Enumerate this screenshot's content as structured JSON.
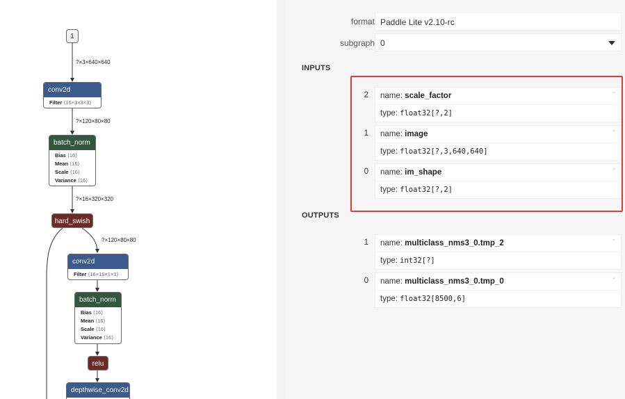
{
  "graph": {
    "input_node": "1",
    "edge_labels": [
      "?×3×640×640",
      "?×120×80×80",
      "?×16×320×320",
      "?×120×80×80"
    ],
    "nodes": [
      {
        "id": "conv2d-1",
        "title": "conv2d",
        "attrs": [
          {
            "k": "Filter",
            "v": "⟨16×3×3×3⟩"
          }
        ]
      },
      {
        "id": "batch-norm-1",
        "title": "batch_norm",
        "attrs": [
          {
            "k": "Bias",
            "v": "⟨16⟩"
          },
          {
            "k": "Mean",
            "v": "⟨16⟩"
          },
          {
            "k": "Scale",
            "v": "⟨16⟩"
          },
          {
            "k": "Variance",
            "v": "⟨16⟩"
          }
        ]
      },
      {
        "id": "hard-swish",
        "title": "hard_swish"
      },
      {
        "id": "conv2d-2",
        "title": "conv2d",
        "attrs": [
          {
            "k": "Filter",
            "v": "⟨16×16×1×1⟩"
          }
        ]
      },
      {
        "id": "batch-norm-2",
        "title": "batch_norm",
        "attrs": [
          {
            "k": "Bias",
            "v": "⟨16⟩"
          },
          {
            "k": "Mean",
            "v": "⟨16⟩"
          },
          {
            "k": "Scale",
            "v": "⟨16⟩"
          },
          {
            "k": "Variance",
            "v": "⟨16⟩"
          }
        ]
      },
      {
        "id": "relu",
        "title": "relu"
      },
      {
        "id": "depthwise-conv2d",
        "title": "depthwise_conv2d"
      }
    ]
  },
  "properties": {
    "format_label": "format",
    "format_value": "Paddle Lite v2.10-rc",
    "subgraph_label": "subgraph",
    "subgraph_value": "0"
  },
  "inputs": {
    "title": "INPUTS",
    "items": [
      {
        "index": "2",
        "name_label": "name: ",
        "name": "scale_factor",
        "type_label": "type: ",
        "type": "float32[?,2]",
        "dash": "-"
      },
      {
        "index": "1",
        "name_label": "name: ",
        "name": "image",
        "type_label": "type: ",
        "type": "float32[?,3,640,640]",
        "dash": "-"
      },
      {
        "index": "0",
        "name_label": "name: ",
        "name": "im_shape",
        "type_label": "type: ",
        "type": "float32[?,2]",
        "dash": "-"
      }
    ]
  },
  "outputs": {
    "title": "OUTPUTS",
    "items": [
      {
        "index": "1",
        "name_label": "name: ",
        "name": "multiclass_nms3_0.tmp_2",
        "type_label": "type: ",
        "type": "int32[?]",
        "dash": "-"
      },
      {
        "index": "0",
        "name_label": "name: ",
        "name": "multiclass_nms3_0.tmp_0",
        "type_label": "type: ",
        "type": "float32[8500,6]",
        "dash": "-"
      }
    ]
  },
  "colors": {
    "highlight": "#e53935",
    "conv": "#3c5a8c",
    "norm": "#335640",
    "activation": "#6d2a24"
  }
}
